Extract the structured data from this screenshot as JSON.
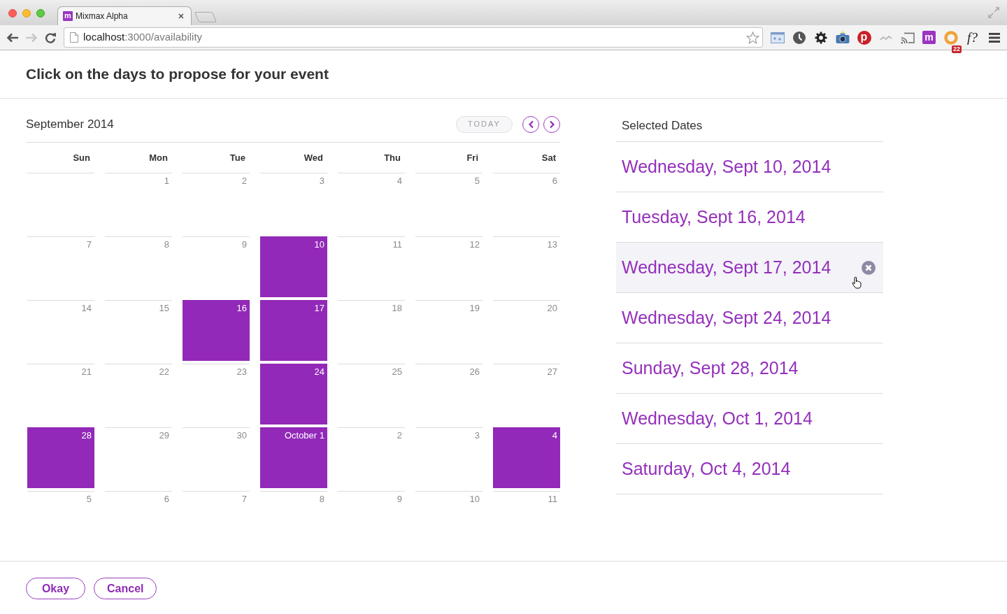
{
  "browser": {
    "tab": {
      "favicon_letter": "m",
      "title": "Mixmax Alpha"
    },
    "nav_buttons": [
      {
        "kind": "back",
        "disabled": false
      },
      {
        "kind": "forward",
        "disabled": true
      },
      {
        "kind": "reload",
        "disabled": false
      }
    ],
    "address": {
      "host": "localhost",
      "path": ":3000/availability"
    },
    "extensions": [
      {
        "kind": "window"
      },
      {
        "kind": "clock"
      },
      {
        "kind": "gear"
      },
      {
        "kind": "camera"
      },
      {
        "kind": "disc",
        "letter": "p"
      },
      {
        "kind": "wave"
      },
      {
        "kind": "cast"
      },
      {
        "kind": "tile",
        "letter": "m"
      },
      {
        "kind": "ring",
        "badge": "22"
      },
      {
        "kind": "text",
        "label": "f?"
      },
      {
        "kind": "menu"
      }
    ]
  },
  "heading": "Click on the days to propose for your event",
  "calendar": {
    "month_title": "September 2014",
    "today_button": {
      "label": "TODAY",
      "disabled": true
    },
    "weekdays": [
      "Sun",
      "Mon",
      "Tue",
      "Wed",
      "Thu",
      "Fri",
      "Sat"
    ],
    "weeks": [
      [
        {
          "selected": false
        },
        {
          "day": "1",
          "selected": false
        },
        {
          "day": "2",
          "selected": false
        },
        {
          "day": "3",
          "selected": false
        },
        {
          "day": "4",
          "selected": false
        },
        {
          "day": "5",
          "selected": false
        },
        {
          "day": "6",
          "selected": false
        }
      ],
      [
        {
          "day": "7",
          "selected": false
        },
        {
          "day": "8",
          "selected": false
        },
        {
          "day": "9",
          "selected": false
        },
        {
          "day": "10",
          "selected": true
        },
        {
          "day": "11",
          "selected": false
        },
        {
          "day": "12",
          "selected": false
        },
        {
          "day": "13",
          "selected": false
        }
      ],
      [
        {
          "day": "14",
          "selected": false
        },
        {
          "day": "15",
          "selected": false
        },
        {
          "day": "16",
          "selected": true
        },
        {
          "day": "17",
          "selected": true
        },
        {
          "day": "18",
          "selected": false
        },
        {
          "day": "19",
          "selected": false
        },
        {
          "day": "20",
          "selected": false
        }
      ],
      [
        {
          "day": "21",
          "selected": false
        },
        {
          "day": "22",
          "selected": false
        },
        {
          "day": "23",
          "selected": false
        },
        {
          "day": "24",
          "selected": true
        },
        {
          "day": "25",
          "selected": false
        },
        {
          "day": "26",
          "selected": false
        },
        {
          "day": "27",
          "selected": false
        }
      ],
      [
        {
          "day": "28",
          "selected": true
        },
        {
          "day": "29",
          "selected": false
        },
        {
          "day": "30",
          "selected": false
        },
        {
          "day": "October 1",
          "selected": true
        },
        {
          "day": "2",
          "selected": false
        },
        {
          "day": "3",
          "selected": false
        },
        {
          "day": "4",
          "selected": true
        }
      ],
      [
        {
          "day": "5",
          "selected": false
        },
        {
          "day": "6",
          "selected": false
        },
        {
          "day": "7",
          "selected": false
        },
        {
          "day": "8",
          "selected": false
        },
        {
          "day": "9",
          "selected": false
        },
        {
          "day": "10",
          "selected": false
        },
        {
          "day": "11",
          "selected": false
        }
      ]
    ]
  },
  "selected_dates": {
    "title": "Selected Dates",
    "items": [
      {
        "label": "Wednesday, Sept 10, 2014",
        "hovered": false
      },
      {
        "label": "Tuesday, Sept 16, 2014",
        "hovered": false
      },
      {
        "label": "Wednesday, Sept 17, 2014",
        "hovered": true
      },
      {
        "label": "Wednesday, Sept 24, 2014",
        "hovered": false
      },
      {
        "label": "Sunday, Sept 28, 2014",
        "hovered": false
      },
      {
        "label": "Wednesday, Oct 1, 2014",
        "hovered": false
      },
      {
        "label": "Saturday, Oct 4, 2014",
        "hovered": false
      }
    ]
  },
  "footer_buttons": [
    {
      "label": "Okay"
    },
    {
      "label": "Cancel"
    }
  ]
}
